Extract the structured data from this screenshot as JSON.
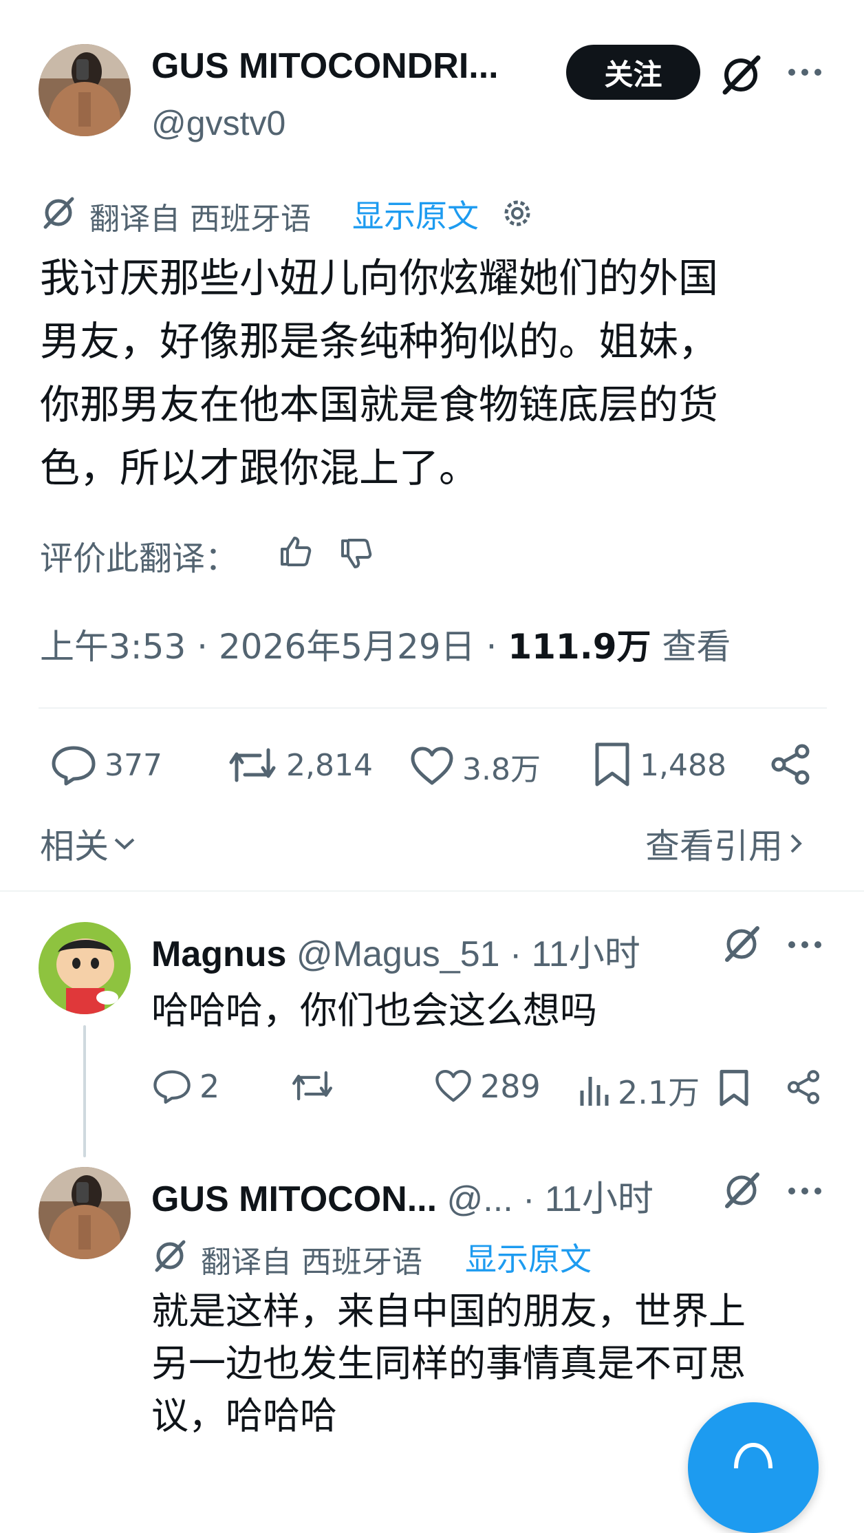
{
  "main_tweet": {
    "display_name": "GUS MITOCONDRI...",
    "handle": "@gvstv0",
    "follow_label": "关注",
    "translated_from": "翻译自 西班牙语",
    "show_original": "显示原文",
    "text_lines": [
      "我讨厌那些小妞儿向你炫耀她们的外国",
      "男友，好像那是条纯种狗似的。姐妹，",
      "你那男友在他本国就是食物链底层的货",
      "色，所以才跟你混上了。"
    ],
    "rate_translation": "评价此翻译：",
    "time": "上午3:53 · 2026年5月29日 ·",
    "views_count": "111.9万",
    "views_label": "查看",
    "replies": "377",
    "retweets": "2,814",
    "likes": "3.8万",
    "bookmarks": "1,488",
    "related": "相关",
    "view_quotes": "查看引用"
  },
  "reply_1": {
    "display_name": "Magnus",
    "handle": "@Magus_51",
    "time": "· 11小时",
    "text": "哈哈哈，你们也会这么想吗",
    "replies": "2",
    "retweets": "",
    "likes": "289",
    "views": "2.1万"
  },
  "reply_2": {
    "display_name": "GUS MITOCON...",
    "handle": "@...",
    "time": "· 11小时",
    "translated_from": "翻译自 西班牙语",
    "show_original": "显示原文",
    "text_lines": [
      "就是这样，来自中国的朋友，世界上",
      "另一边也发生同样的事情真是不可思",
      "议，哈哈哈"
    ]
  },
  "colors": {
    "text": "#0f1419",
    "muted": "#536471",
    "accent": "#1d9bf0",
    "divider": "#eff3f4"
  },
  "icons": {
    "grok": "grok-slash-icon",
    "more": "more-dots-icon",
    "reply": "reply-bubble-icon",
    "retweet": "retweet-icon",
    "like": "heart-icon",
    "bookmark": "bookmark-icon",
    "share": "share-icon",
    "views": "views-bar-icon",
    "gear": "gear-icon",
    "thumbs_up": "thumbs-up-icon",
    "thumbs_down": "thumbs-down-icon",
    "compose": "compose-fab-icon"
  }
}
